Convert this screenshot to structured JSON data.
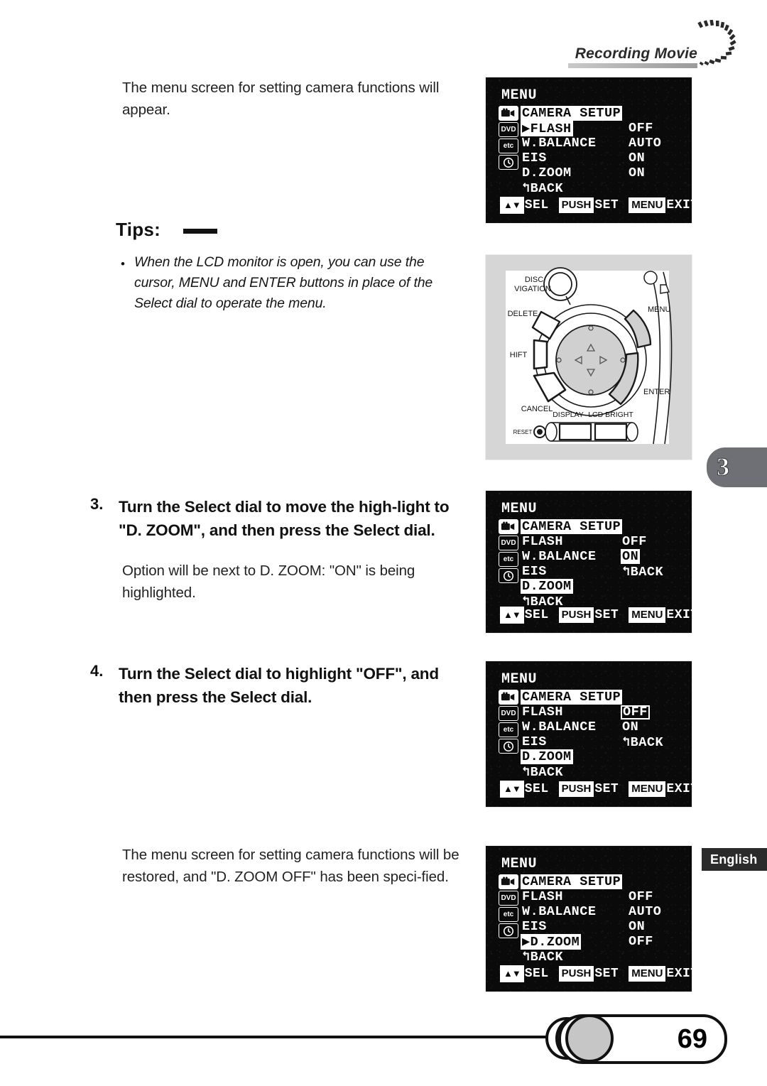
{
  "header": {
    "title": "Recording Movie",
    "arc_icon": "dotted-arc-icon"
  },
  "body": {
    "intro_paragraph": "The menu screen for setting camera functions will appear.",
    "tips_heading": "Tips:",
    "tips_bullet": "•",
    "tips_text": "When the LCD monitor is open, you can use the cursor, MENU and ENTER buttons in place of the Select dial to operate the menu.",
    "step3_number": "3.",
    "step3_text": "Turn the Select dial to move the high-light to \"D. ZOOM\", and then press the Select dial.",
    "step3_sub": "Option will be next to D. ZOOM: \"ON\" is being highlighted.",
    "step4_number": "4.",
    "step4_text": "Turn the Select dial to highlight \"OFF\", and then press the Select dial.",
    "final_paragraph": "The menu screen for setting camera functions will be restored, and \"D. ZOOM OFF\" has been speci-fied."
  },
  "lcd_common": {
    "title": "MENU",
    "icons": [
      {
        "name": "camera-icon",
        "glyph": "Ἲ5"
      },
      {
        "name": "dvd-icon",
        "glyph": "DVD"
      },
      {
        "name": "etc-icon",
        "glyph": "etc"
      },
      {
        "name": "clock-icon",
        "glyph": "◴"
      }
    ],
    "guide": {
      "sel_key": "▲▼",
      "sel_label": "SEL",
      "set_key": "PUSH",
      "set_label": "SET",
      "exit_key": "MENU",
      "exit_label": "EXIT"
    }
  },
  "lcd_screens": [
    {
      "id": "screen-1-camera-setup",
      "rows": [
        {
          "label": "CAMERA SETUP",
          "highlight": true,
          "caret": false
        },
        {
          "label": "FLASH",
          "highlight": true,
          "caret": true
        },
        {
          "label": "W.BALANCE",
          "highlight": false,
          "caret": false
        },
        {
          "label": "EIS",
          "highlight": false,
          "caret": false
        },
        {
          "label": "D.ZOOM",
          "highlight": false,
          "caret": false
        },
        {
          "label": "↰BACK",
          "highlight": false,
          "caret": false
        }
      ],
      "values": [
        {
          "text": "",
          "highlight": false,
          "boxed": false
        },
        {
          "text": "OFF",
          "highlight": false,
          "boxed": false
        },
        {
          "text": "AUTO",
          "highlight": false,
          "boxed": false
        },
        {
          "text": "ON",
          "highlight": false,
          "boxed": false
        },
        {
          "text": "ON",
          "highlight": false,
          "boxed": false
        },
        {
          "text": "",
          "highlight": false,
          "boxed": false
        }
      ]
    },
    {
      "id": "screen-2-dzoom-selected",
      "rows": [
        {
          "label": "CAMERA SETUP",
          "highlight": true,
          "caret": false
        },
        {
          "label": "FLASH",
          "highlight": false,
          "caret": false
        },
        {
          "label": "W.BALANCE",
          "highlight": false,
          "caret": false
        },
        {
          "label": "EIS",
          "highlight": false,
          "caret": false
        },
        {
          "label": "D.ZOOM",
          "highlight": true,
          "caret": false
        },
        {
          "label": "↰BACK",
          "highlight": false,
          "caret": false
        }
      ],
      "values": [
        {
          "text": "",
          "highlight": false,
          "boxed": false
        },
        {
          "text": "OFF",
          "highlight": false,
          "boxed": false
        },
        {
          "text": "ON",
          "highlight": true,
          "boxed": false
        },
        {
          "text": "↰BACK",
          "highlight": false,
          "boxed": false
        },
        {
          "text": "",
          "highlight": false,
          "boxed": false
        },
        {
          "text": "",
          "highlight": false,
          "boxed": false
        }
      ]
    },
    {
      "id": "screen-3-off-highlighted",
      "rows": [
        {
          "label": "CAMERA SETUP",
          "highlight": true,
          "caret": false
        },
        {
          "label": "FLASH",
          "highlight": false,
          "caret": false
        },
        {
          "label": "W.BALANCE",
          "highlight": false,
          "caret": false
        },
        {
          "label": "EIS",
          "highlight": false,
          "caret": false
        },
        {
          "label": "D.ZOOM",
          "highlight": true,
          "caret": false
        },
        {
          "label": "↰BACK",
          "highlight": false,
          "caret": false
        }
      ],
      "values": [
        {
          "text": "",
          "highlight": false,
          "boxed": false
        },
        {
          "text": "OFF",
          "highlight": false,
          "boxed": true
        },
        {
          "text": "ON",
          "highlight": false,
          "boxed": false
        },
        {
          "text": "↰BACK",
          "highlight": false,
          "boxed": false
        },
        {
          "text": "",
          "highlight": false,
          "boxed": false
        },
        {
          "text": "",
          "highlight": false,
          "boxed": false
        }
      ]
    },
    {
      "id": "screen-4-dzoom-off-set",
      "rows": [
        {
          "label": "CAMERA SETUP",
          "highlight": true,
          "caret": false
        },
        {
          "label": "FLASH",
          "highlight": false,
          "caret": false
        },
        {
          "label": "W.BALANCE",
          "highlight": false,
          "caret": false
        },
        {
          "label": "EIS",
          "highlight": false,
          "caret": false
        },
        {
          "label": "D.ZOOM",
          "highlight": true,
          "caret": true
        },
        {
          "label": "↰BACK",
          "highlight": false,
          "caret": false
        }
      ],
      "values": [
        {
          "text": "",
          "highlight": false,
          "boxed": false
        },
        {
          "text": "OFF",
          "highlight": false,
          "boxed": false
        },
        {
          "text": "AUTO",
          "highlight": false,
          "boxed": false
        },
        {
          "text": "ON",
          "highlight": false,
          "boxed": false
        },
        {
          "text": "OFF",
          "highlight": false,
          "boxed": false
        },
        {
          "text": "",
          "highlight": false,
          "boxed": false
        }
      ]
    }
  ],
  "diagram": {
    "name": "camera-control-panel-diagram",
    "labels": {
      "disc_navigation_l1": "DISC",
      "disc_navigation_l2": "VIGATION",
      "delete": "DELETE",
      "shift": "HIFT",
      "cancel": "CANCEL",
      "menu": "MENU",
      "enter": "ENTER",
      "display": "DISPLAY",
      "lcd_bright": "LCD BRIGHT",
      "reset": "RESET"
    },
    "cursor_arrows": [
      "△",
      "◁",
      "▷",
      "▽"
    ],
    "highlight_color": "#d0d0d0"
  },
  "side_tabs": {
    "chapter_number": "3",
    "language": "English"
  },
  "footer": {
    "page_number": "69"
  }
}
